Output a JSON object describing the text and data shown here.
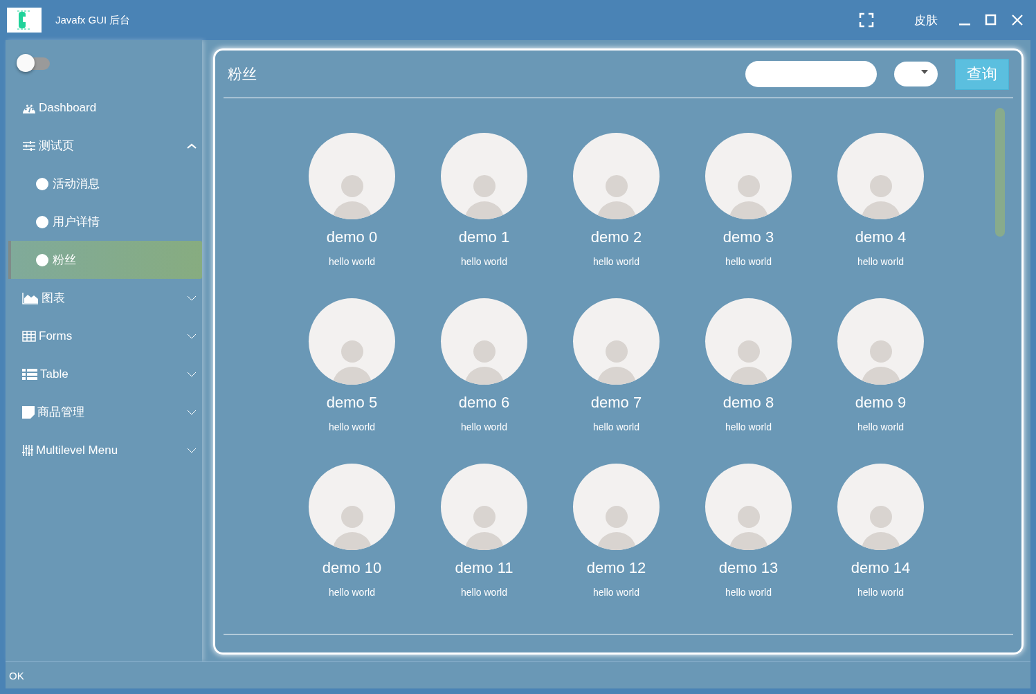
{
  "window": {
    "title": "Javafx GUI 后台",
    "skin_label": "皮肤"
  },
  "sidebar": {
    "toggle": {
      "on": false
    },
    "items": [
      {
        "label": "Dashboard",
        "kind": "link"
      },
      {
        "label": "测试页",
        "kind": "group",
        "expanded": true,
        "children": [
          {
            "label": "活动消息",
            "selected": false
          },
          {
            "label": "用户详情",
            "selected": false
          },
          {
            "label": "粉丝",
            "selected": true
          }
        ]
      },
      {
        "label": "图表",
        "kind": "group",
        "expanded": false
      },
      {
        "label": "Forms",
        "kind": "group",
        "expanded": false
      },
      {
        "label": "Table",
        "kind": "group",
        "expanded": false
      },
      {
        "label": "商品管理",
        "kind": "group",
        "expanded": false
      },
      {
        "label": "Multilevel Menu",
        "kind": "group",
        "expanded": false
      }
    ]
  },
  "content": {
    "title": "粉丝",
    "query_button": "查询",
    "cards": [
      {
        "name": "demo 0",
        "subtitle": "hello world"
      },
      {
        "name": "demo 1",
        "subtitle": "hello world"
      },
      {
        "name": "demo 2",
        "subtitle": "hello world"
      },
      {
        "name": "demo 3",
        "subtitle": "hello world"
      },
      {
        "name": "demo 4",
        "subtitle": "hello world"
      },
      {
        "name": "demo 5",
        "subtitle": "hello world"
      },
      {
        "name": "demo 6",
        "subtitle": "hello world"
      },
      {
        "name": "demo 7",
        "subtitle": "hello world"
      },
      {
        "name": "demo 8",
        "subtitle": "hello world"
      },
      {
        "name": "demo 9",
        "subtitle": "hello world"
      },
      {
        "name": "demo 10",
        "subtitle": "hello world"
      },
      {
        "name": "demo 11",
        "subtitle": "hello world"
      },
      {
        "name": "demo 12",
        "subtitle": "hello world"
      },
      {
        "name": "demo 13",
        "subtitle": "hello world"
      },
      {
        "name": "demo 14",
        "subtitle": "hello world"
      }
    ]
  },
  "status_bar": "OK"
}
